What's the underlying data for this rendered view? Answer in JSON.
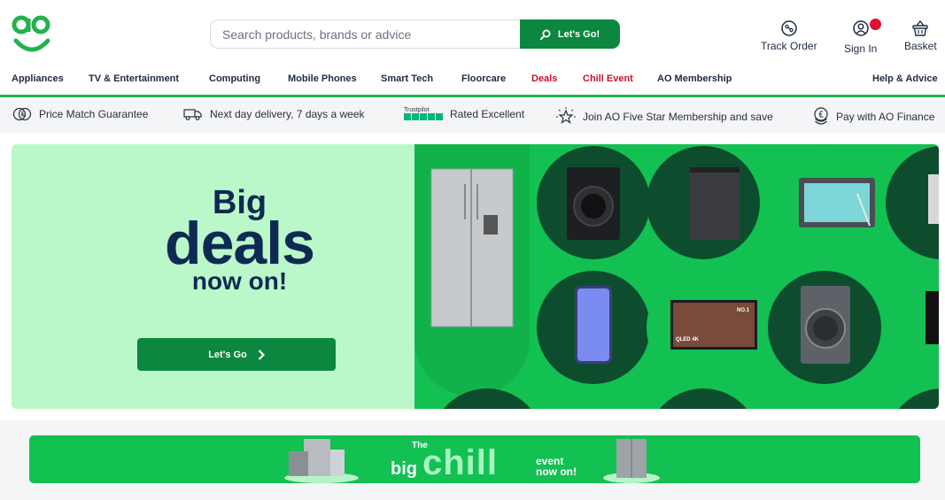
{
  "header": {
    "logo_text": "ao",
    "search": {
      "placeholder": "Search products, brands or advice",
      "button_label": "Let's Go!"
    },
    "actions": [
      {
        "label": "Track Order",
        "icon": "track-order-icon"
      },
      {
        "label": "Sign In",
        "icon": "user-icon"
      },
      {
        "label": "Basket",
        "icon": "basket-icon"
      }
    ]
  },
  "nav": {
    "items": [
      {
        "label": "Appliances"
      },
      {
        "label": "TV & Entertainment"
      },
      {
        "label": "Computing"
      },
      {
        "label": "Mobile Phones"
      },
      {
        "label": "Smart Tech"
      },
      {
        "label": "Floorcare"
      },
      {
        "label": "Deals",
        "highlight": true
      },
      {
        "label": "Chill Event",
        "highlight": true
      },
      {
        "label": "AO Membership"
      }
    ],
    "help_label": "Help & Advice"
  },
  "usps": [
    {
      "label": "Price Match Guarantee",
      "icon": "price-match-icon"
    },
    {
      "label": "Next day delivery, 7 days a week",
      "icon": "delivery-truck-icon"
    },
    {
      "label": "Rated Excellent",
      "icon": "trustpilot-logo",
      "brand": "Trustpilot"
    },
    {
      "label": "Join AO Five Star Membership and save",
      "icon": "star-icon"
    },
    {
      "label": "Pay with AO Finance",
      "icon": "finance-coin-icon"
    }
  ],
  "hero": {
    "title_line1": "Big",
    "title_line2": "deals",
    "title_line3": "now on!",
    "button_label": "Let's Go",
    "tv_badge": "NO.1",
    "tv_brand": "QLED 4K"
  },
  "chill_banner": {
    "the": "The",
    "big": "big",
    "chill": "chill",
    "event": "event",
    "now_on": "now on!"
  },
  "colors": {
    "brand_green": "#21b24b",
    "button_green": "#0b8740",
    "hero_bg": "#baf7c9",
    "navy": "#0f2a52",
    "deal_red": "#c8102e"
  }
}
